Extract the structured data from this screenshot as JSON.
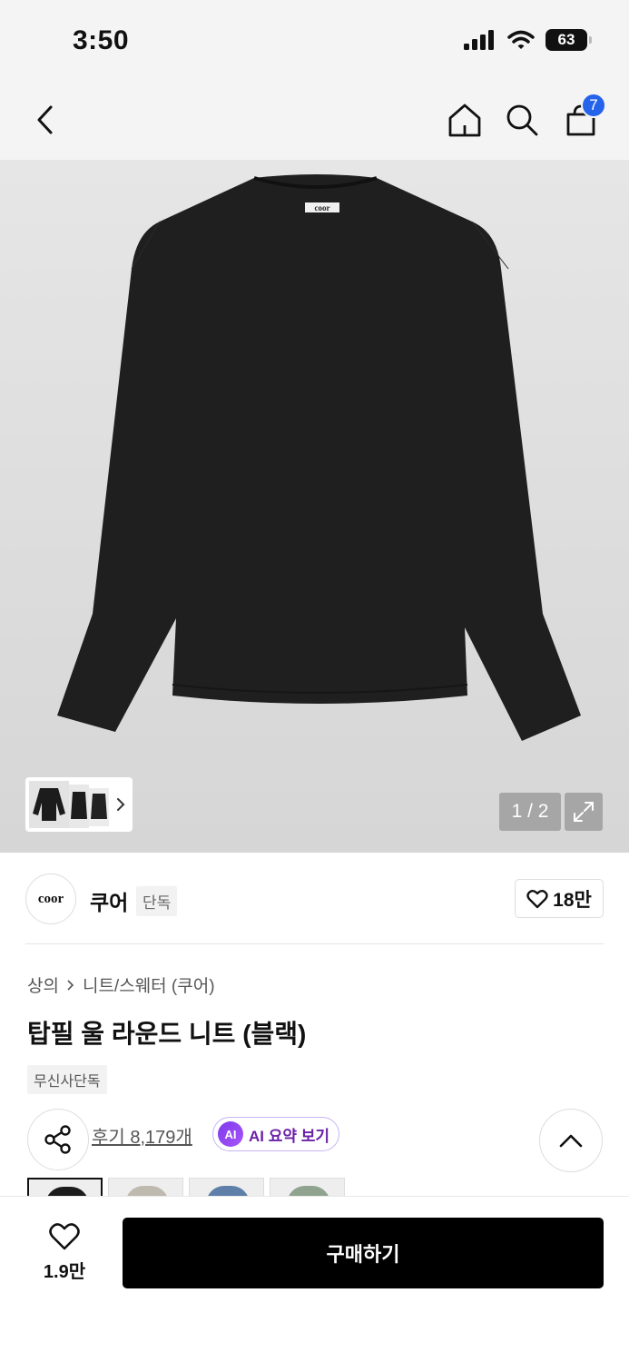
{
  "status_bar": {
    "time": "3:50",
    "battery": "63"
  },
  "nav": {
    "cart_count": "7"
  },
  "product_image": {
    "brand_label": "coor",
    "counter": "1 / 2"
  },
  "brand": {
    "logo_text": "coor",
    "name": "쿠어",
    "tag": "단독",
    "likes": "18만"
  },
  "breadcrumb": {
    "category": "상의",
    "subcategory": "니트/스웨터 (쿠어)"
  },
  "product": {
    "title": "탑필 울 라운드 니트 (블랙)",
    "exclusive_tag": "무신사단독"
  },
  "reviews": {
    "link_text": "후기 8,179개",
    "ai_badge": "AI",
    "ai_label": "AI 요약 보기"
  },
  "colors": {
    "swatch_colors": [
      "#1c1c1c",
      "#bfbab0",
      "#5d7fa8",
      "#8fa38f"
    ]
  },
  "bottom_bar": {
    "wish_count": "1.9만",
    "buy_label": "구매하기"
  }
}
